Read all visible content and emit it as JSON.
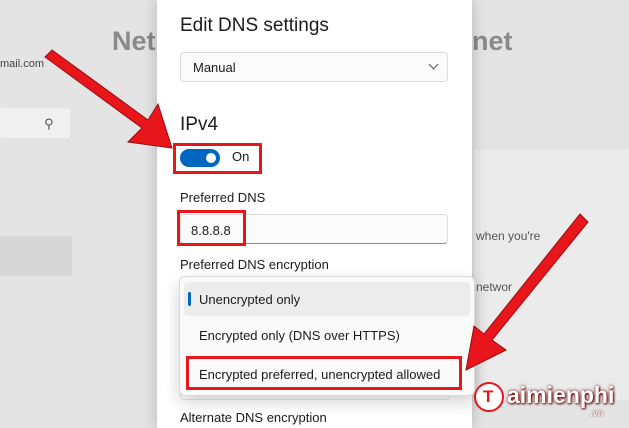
{
  "background": {
    "title_left": "Net",
    "title_right": "net",
    "email": "mail.com",
    "line1": "when you're",
    "line2": "networ"
  },
  "dialog": {
    "title": "Edit DNS settings",
    "mode_select": {
      "value": "Manual"
    },
    "section_title": "IPv4",
    "toggle": {
      "label": "On",
      "state": "on"
    },
    "preferred_dns": {
      "label": "Preferred DNS",
      "value": "8.8.8.8"
    },
    "preferred_encryption": {
      "label": "Preferred DNS encryption"
    },
    "alternate_encryption": {
      "label": "Alternate DNS encryption"
    }
  },
  "encryption_menu": {
    "items": [
      {
        "label": "Unencrypted only",
        "selected": true
      },
      {
        "label": "Encrypted only (DNS over HTTPS)",
        "selected": false
      },
      {
        "label": "Encrypted preferred, unencrypted allowed",
        "selected": false
      }
    ]
  },
  "watermark": {
    "brand": "aimienphi",
    "brand_initial": "T",
    "suffix": ".vn"
  },
  "colors": {
    "accent": "#0067c0",
    "highlight": "#e8151b"
  }
}
